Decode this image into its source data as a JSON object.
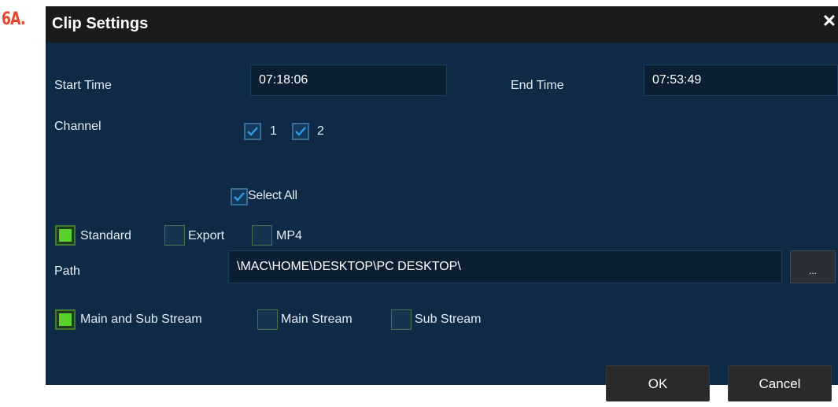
{
  "step_label": "6A.",
  "dialog": {
    "title": "Clip Settings",
    "close_icon": "close-icon"
  },
  "start_time": {
    "label": "Start Time",
    "value": "07:18:06"
  },
  "end_time": {
    "label": "End Time",
    "value": "07:53:49"
  },
  "channel": {
    "label": "Channel",
    "items": [
      {
        "label": "1",
        "checked": true
      },
      {
        "label": "2",
        "checked": true
      }
    ]
  },
  "select_all": {
    "label": "Select All",
    "checked": true
  },
  "format": {
    "options": [
      {
        "label": "Standard",
        "selected": true
      },
      {
        "label": "Export",
        "selected": false
      },
      {
        "label": "MP4",
        "selected": false
      }
    ]
  },
  "path": {
    "label": "Path",
    "value": "\\MAC\\HOME\\DESKTOP\\PC DESKTOP\\",
    "browse_label": "..."
  },
  "stream": {
    "options": [
      {
        "label": "Main and Sub Stream",
        "selected": true
      },
      {
        "label": "Main Stream",
        "selected": false
      },
      {
        "label": "Sub Stream",
        "selected": false
      }
    ]
  },
  "buttons": {
    "ok": "OK",
    "cancel": "Cancel"
  },
  "colors": {
    "background": "#0f2a46",
    "titlebar": "#1b1b1b",
    "check_accent": "#2e9be6",
    "selected_green": "#5ad12a"
  }
}
